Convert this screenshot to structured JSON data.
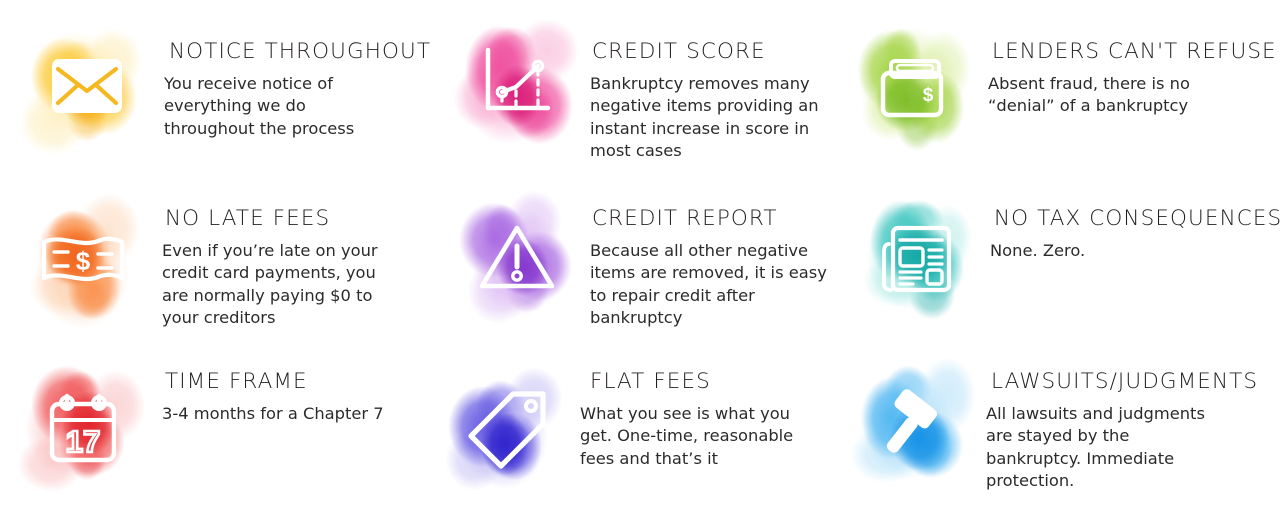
{
  "infographic": {
    "columns": 3,
    "rows": 3,
    "background": "#ffffff",
    "heading_color": "#231f20",
    "body_color": "#2b2b2b",
    "items": [
      {
        "id": "notice-throughout",
        "heading": "NOTICE THROUGHOUT",
        "body": "You receive notice of\neverything we do\nthroughout  the process",
        "icon": "envelope-icon",
        "color": "#f5b820",
        "blob_colors": [
          "#fde9a8",
          "#fbc62b",
          "#f5a90f"
        ]
      },
      {
        "id": "credit-score",
        "heading": "CREDIT SCORE",
        "body": "Bankruptcy  removes many\nnegative items providing  an\ninstant  increase  in score in\nmost cases",
        "icon": "line-chart-icon",
        "color": "#e8308a",
        "blob_colors": [
          "#f7a6cd",
          "#ee3f96",
          "#d81b77"
        ]
      },
      {
        "id": "lenders-cant-refuse",
        "heading": "LENDERS CAN'T REFUSE",
        "body": "Absent fraud, there is no\n“denial” of a bankruptcy",
        "icon": "wallet-icon",
        "color": "#8dc63f",
        "blob_colors": [
          "#d7ec9a",
          "#9ed13b",
          "#79bb22"
        ]
      },
      {
        "id": "no-late-fees",
        "heading": "NO LATE FEES",
        "body": "Even if you’re late on your\ncredit card payments, you\nare normally  paying  $0 to\nyour creditors",
        "icon": "banknote-icon",
        "color": "#f47b20",
        "blob_colors": [
          "#fcd0ad",
          "#f9853a",
          "#f0631a"
        ]
      },
      {
        "id": "credit-report",
        "heading": "CREDIT REPORT",
        "body": "Because all other negative\nitems are removed, it is easy\nto repair credit after\nbankruptcy",
        "icon": "warning-triangle-icon",
        "color": "#9b4fd8",
        "blob_colors": [
          "#d9b4f2",
          "#a35fe0",
          "#8334cc"
        ]
      },
      {
        "id": "no-tax-consequences",
        "heading": "NO TAX CONSEQUENCES",
        "body": "None. Zero.",
        "icon": "newspaper-icon",
        "color": "#17b3b0",
        "blob_colors": [
          "#a8e8e3",
          "#2ec0ba",
          "#11a7a4"
        ]
      },
      {
        "id": "time-frame",
        "heading": "TIME FRAME",
        "body": "3-4 months  for a Chapter 7",
        "icon": "calendar-icon",
        "color": "#ef3e42",
        "blob_colors": [
          "#f9b3b4",
          "#ef4b4d",
          "#e02229"
        ]
      },
      {
        "id": "flat-fees",
        "heading": "FLAT FEES",
        "body": "What you see is what you\nget. One-time,  reasonable\nfees and that’s  it",
        "icon": "price-tag-icon",
        "color": "#3a2fd6",
        "blob_colors": [
          "#b9b2f2",
          "#574bdf",
          "#2f23cc"
        ]
      },
      {
        "id": "lawsuits-judgments",
        "heading": "LAWSUITS/JUDGMENTS",
        "body": "All lawsuits  and judgments\nare stayed by the\nbankruptcy.  Immediate\nprotection.",
        "icon": "gavel-icon",
        "color": "#29a3ee",
        "blob_colors": [
          "#a9dcf8",
          "#3fb0f0",
          "#1691e6"
        ]
      }
    ]
  }
}
